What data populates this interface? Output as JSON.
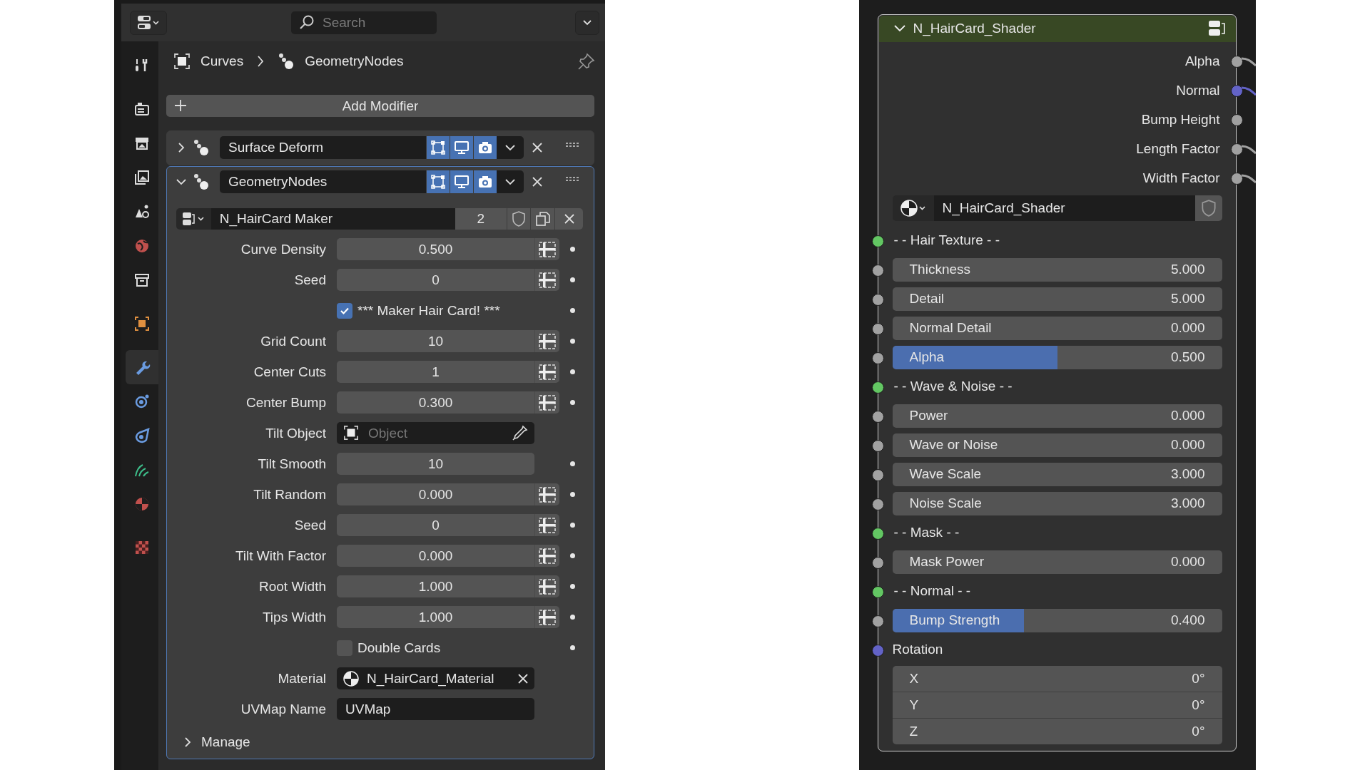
{
  "header": {
    "search": {
      "placeholder": "Search"
    }
  },
  "sidebar": {
    "tabs": [
      {
        "selected": false
      },
      {
        "selected": false
      },
      {
        "selected": false
      },
      {
        "selected": false
      },
      {
        "selected": false
      },
      {
        "selected": false
      },
      {
        "selected": false
      },
      {
        "selected": false
      },
      {
        "selected": true
      },
      {
        "selected": false
      },
      {
        "selected": false
      },
      {
        "selected": false
      },
      {
        "selected": false
      },
      {
        "selected": false
      }
    ]
  },
  "breadcrumb": {
    "object": "Curves",
    "modifier": "GeometryNodes"
  },
  "add_modifier": {
    "label": "Add Modifier"
  },
  "modifiers": [
    {
      "name": "Surface Deform",
      "expanded": false,
      "selected": false,
      "toggles": [
        {
          "on": true
        },
        {
          "on": true
        },
        {
          "on": true
        }
      ]
    },
    {
      "name": "GeometryNodes",
      "expanded": true,
      "selected": true,
      "toggles": [
        {
          "on": true
        },
        {
          "on": true
        },
        {
          "on": true
        }
      ],
      "node_group": {
        "name": "N_HairCard Maker",
        "users": "2"
      },
      "params": [
        {
          "kind": "number",
          "label": "Curve Density",
          "value": "0.500",
          "attribute_toggle": true
        },
        {
          "kind": "number",
          "label": "Seed",
          "value": "0",
          "attribute_toggle": true
        },
        {
          "kind": "checkbox",
          "label": "*** Maker Hair Card! ***",
          "checked": true
        },
        {
          "kind": "number",
          "label": "Grid Count",
          "value": "10",
          "attribute_toggle": true
        },
        {
          "kind": "number",
          "label": "Center Cuts",
          "value": "1",
          "attribute_toggle": true
        },
        {
          "kind": "number",
          "label": "Center Bump",
          "value": "0.300",
          "attribute_toggle": true
        },
        {
          "kind": "object",
          "label": "Tilt Object",
          "placeholder": "Object"
        },
        {
          "kind": "number",
          "label": "Tilt Smooth",
          "value": "10",
          "attribute_toggle": false
        },
        {
          "kind": "number",
          "label": "Tilt Random",
          "value": "0.000",
          "attribute_toggle": true
        },
        {
          "kind": "number",
          "label": "Seed",
          "value": "0",
          "attribute_toggle": true
        },
        {
          "kind": "number",
          "label": "Tilt With Factor",
          "value": "0.000",
          "attribute_toggle": true
        },
        {
          "kind": "number",
          "label": "Root Width",
          "value": "1.000",
          "attribute_toggle": true
        },
        {
          "kind": "number",
          "label": "Tips Width",
          "value": "1.000",
          "attribute_toggle": true
        },
        {
          "kind": "checkbox",
          "label": "Double Cards",
          "checked": false
        },
        {
          "kind": "material",
          "label": "Material",
          "value": "N_HairCard_Material"
        },
        {
          "kind": "text",
          "label": "UVMap Name",
          "value": "UVMap"
        }
      ],
      "manage": {
        "label": "Manage",
        "expanded": false
      }
    }
  ],
  "node": {
    "title": "N_HairCard_Shader",
    "outputs": [
      {
        "name": "Alpha",
        "color": "#a1a1a1",
        "linked": true
      },
      {
        "name": "Normal",
        "color": "#6363c7",
        "linked": true
      },
      {
        "name": "Bump Height",
        "color": "#a1a1a1",
        "linked": false
      },
      {
        "name": "Length Factor",
        "color": "#a1a1a1",
        "linked": true
      },
      {
        "name": "Width Factor",
        "color": "#a1a1a1",
        "linked": true
      }
    ],
    "material": {
      "name": "N_HairCard_Shader"
    },
    "inputs": [
      {
        "kind": "panel",
        "label": "- - Hair Texture - -",
        "color": "#63c763"
      },
      {
        "kind": "value",
        "label": "Thickness",
        "value": "5.000",
        "color": "#a1a1a1"
      },
      {
        "kind": "value",
        "label": "Detail",
        "value": "5.000",
        "color": "#a1a1a1"
      },
      {
        "kind": "value",
        "label": "Normal Detail",
        "value": "0.000",
        "color": "#a1a1a1"
      },
      {
        "kind": "factor",
        "label": "Alpha",
        "value": "0.500",
        "level": 0.5,
        "color": "#a1a1a1"
      },
      {
        "kind": "panel",
        "label": "- - Wave & Noise - -",
        "color": "#63c763"
      },
      {
        "kind": "value",
        "label": "Power",
        "value": "0.000",
        "color": "#a1a1a1"
      },
      {
        "kind": "value",
        "label": "Wave or Noise",
        "value": "0.000",
        "color": "#a1a1a1"
      },
      {
        "kind": "value",
        "label": "Wave Scale",
        "value": "3.000",
        "color": "#a1a1a1"
      },
      {
        "kind": "value",
        "label": "Noise Scale",
        "value": "3.000",
        "color": "#a1a1a1"
      },
      {
        "kind": "panel",
        "label": "- - Mask - -",
        "color": "#63c763"
      },
      {
        "kind": "value",
        "label": "Mask Power",
        "value": "0.000",
        "color": "#a1a1a1"
      },
      {
        "kind": "panel",
        "label": "- - Normal - -",
        "color": "#63c763"
      },
      {
        "kind": "factor",
        "label": "Bump Strength",
        "value": "0.400",
        "level": 0.4,
        "color": "#a1a1a1"
      },
      {
        "kind": "vector",
        "label": "Rotation",
        "color": "#6363c7",
        "components": [
          {
            "axis": "X",
            "value": "0°"
          },
          {
            "axis": "Y",
            "value": "0°"
          },
          {
            "axis": "Z",
            "value": "0°"
          }
        ]
      }
    ]
  }
}
